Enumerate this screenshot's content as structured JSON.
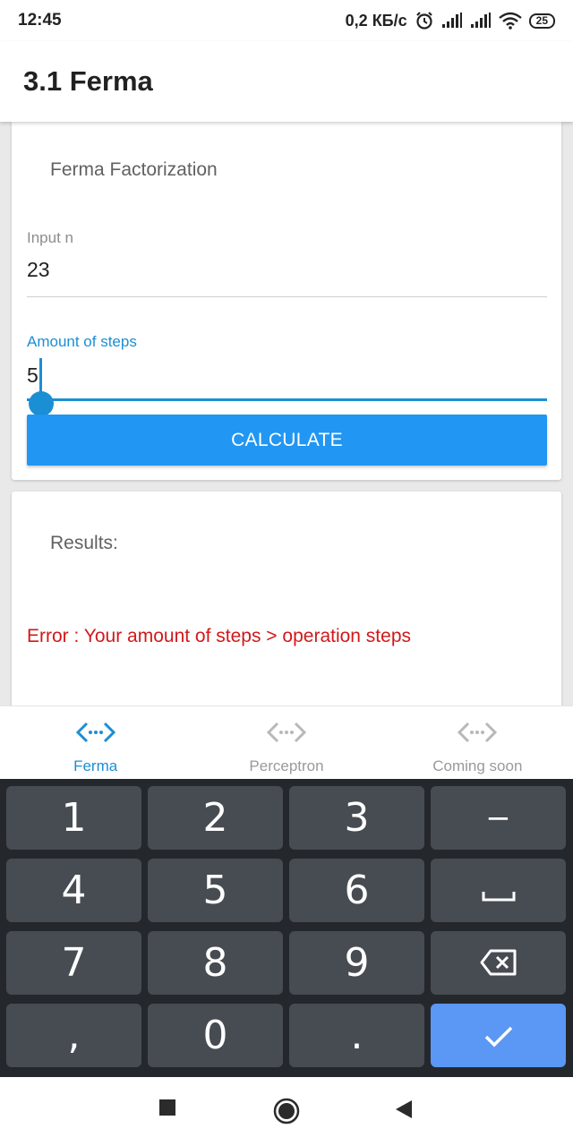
{
  "status_bar": {
    "time": "12:45",
    "network_speed": "0,2 КБ/с",
    "battery_level": "25",
    "icons": [
      "alarm-icon",
      "signal-icon",
      "signal-icon",
      "wifi-icon",
      "battery-icon"
    ]
  },
  "app_bar": {
    "title": "3.1 Ferma"
  },
  "calc_card": {
    "heading": "Ferma Factorization",
    "input_label": "Input n",
    "input_value": "23",
    "steps_label": "Amount of steps",
    "steps_value": "5",
    "button_label": "CALCULATE"
  },
  "results_card": {
    "heading": "Results:",
    "error_message": "Error : Your amount of steps > operation steps"
  },
  "bottom_nav": {
    "items": [
      {
        "label": "Ferma",
        "icon": "code-arrows-icon",
        "active": true
      },
      {
        "label": "Perceptron",
        "icon": "code-arrows-icon",
        "active": false
      },
      {
        "label": "Coming soon",
        "icon": "code-arrows-icon",
        "active": false
      }
    ]
  },
  "keyboard": {
    "keys": [
      "1",
      "2",
      "3",
      "−",
      "4",
      "5",
      "6",
      "space",
      "7",
      "8",
      "9",
      "backspace",
      ",",
      "0",
      ".",
      "enter"
    ]
  },
  "colors": {
    "accent": "#2196f3",
    "label_blue": "#1b8fd4",
    "error_red": "#d0191a",
    "keyboard_bg": "#24282d",
    "key_bg": "#474c52",
    "enter_key": "#5b97f4"
  }
}
